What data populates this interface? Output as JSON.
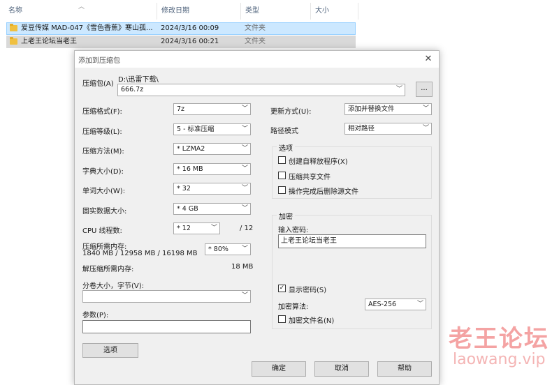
{
  "explorer": {
    "columns": {
      "name": "名称",
      "modified": "修改日期",
      "type": "类型",
      "size": "大小"
    },
    "files": [
      {
        "name": "爱豆传媒 MAD-047《雪色香蕉》寒山孤...",
        "modified": "2024/3/16 00:09",
        "type": "文件夹"
      },
      {
        "name": "上老王论坛当老王",
        "modified": "2024/3/16 00:21",
        "type": "文件夹"
      }
    ]
  },
  "dialog": {
    "title": "添加到压缩包",
    "close": "✕",
    "archive": {
      "label": "压缩包(A)",
      "path": "D:\\迅雷下载\\",
      "filename": "666.7z",
      "browse": "..."
    },
    "format": {
      "label": "压缩格式(F):",
      "value": "7z"
    },
    "level": {
      "label": "压缩等级(L):",
      "value": "5 - 标准压缩"
    },
    "method": {
      "label": "压缩方法(M):",
      "value": "* LZMA2"
    },
    "dict": {
      "label": "字典大小(D):",
      "value": "* 16 MB"
    },
    "word": {
      "label": "单词大小(W):",
      "value": "* 32"
    },
    "solid": {
      "label": "固实数据大小:",
      "value": "* 4 GB"
    },
    "cpu": {
      "label": "CPU 线程数:",
      "value": "* 12",
      "total": "/ 12"
    },
    "mem_comp": {
      "label": "压缩所需内存:",
      "detail": "1840 MB / 12958 MB / 16198 MB",
      "value": "* 80%"
    },
    "mem_decomp": {
      "label": "解压缩所需内存:",
      "value": "18 MB"
    },
    "volume": {
      "label": "分卷大小，字节(V):",
      "value": ""
    },
    "params": {
      "label": "参数(P):",
      "value": ""
    },
    "options_button": "选项",
    "update": {
      "label": "更新方式(U):",
      "value": "添加并替换文件"
    },
    "pathmode": {
      "label": "路径模式",
      "value": "相对路径"
    },
    "options_group": {
      "title": "选项",
      "sfx": {
        "label": "创建自释放程序(X)",
        "checked": false
      },
      "shared": {
        "label": "压缩共享文件",
        "checked": false
      },
      "delete": {
        "label": "操作完成后删除源文件",
        "checked": false
      }
    },
    "encryption": {
      "title": "加密",
      "password_label": "输入密码:",
      "password": "上老王论坛当老王",
      "show": {
        "label": "显示密码(S)",
        "checked": true,
        "mark": "✓"
      },
      "method_label": "加密算法:",
      "method": "AES-256",
      "encrypt_names": {
        "label": "加密文件名(N)",
        "checked": false
      }
    },
    "buttons": {
      "ok": "确定",
      "cancel": "取消",
      "help": "帮助"
    }
  },
  "watermark": {
    "text": "老王论坛",
    "url": "laowang.vip"
  }
}
